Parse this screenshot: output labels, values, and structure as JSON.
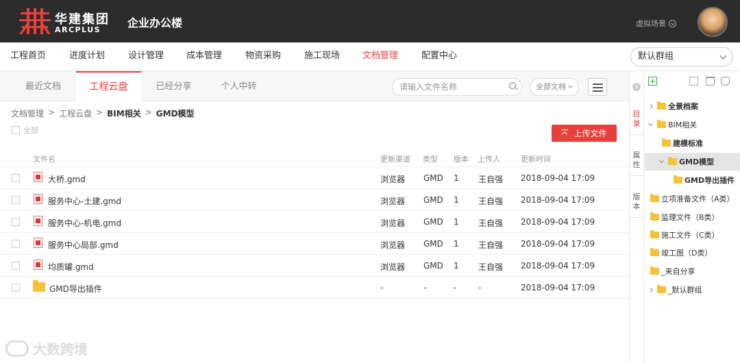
{
  "header": {
    "brand_cn": "华建集团",
    "brand_en": "ARCPLUS",
    "app_title": "企业办公楼",
    "scene_label": "虚拟场景",
    "brand_color": "#e8403c"
  },
  "nav": {
    "items": [
      "工程首页",
      "进度计划",
      "设计管理",
      "成本管理",
      "物资采购",
      "施工现场",
      "文档管理",
      "配置中心"
    ],
    "active": "文档管理",
    "group_select": "默认群组"
  },
  "tabs": {
    "items": [
      "最近文档",
      "工程云盘",
      "已经分享",
      "个人中转"
    ],
    "active": "工程云盘"
  },
  "toolbar": {
    "search_placeholder": "请输入文件名称",
    "filter_label": "全部文档",
    "upload_label": "上传文件"
  },
  "breadcrumb": [
    "文档管理",
    "工程云盘",
    "BIM相关",
    "GMD模型"
  ],
  "select_all_label": "全部",
  "table": {
    "columns": [
      "文件名",
      "更新渠道",
      "类型",
      "版本",
      "上传人",
      "更新时间"
    ],
    "rows": [
      {
        "name": "大桥.gmd",
        "channel": "浏览器",
        "type": "GMD",
        "version": "1",
        "uploader": "王自强",
        "time": "2018-09-04 17:09",
        "kind": "file"
      },
      {
        "name": "服务中心-土建.gmd",
        "channel": "浏览器",
        "type": "GMD",
        "version": "1",
        "uploader": "王自强",
        "time": "2018-09-04 17:09",
        "kind": "file"
      },
      {
        "name": "服务中心-机电.gmd",
        "channel": "浏览器",
        "type": "GMD",
        "version": "1",
        "uploader": "王自强",
        "time": "2018-09-04 17:09",
        "kind": "file"
      },
      {
        "name": "服务中心局部.gmd",
        "channel": "浏览器",
        "type": "GMD",
        "version": "1",
        "uploader": "王自强",
        "time": "2018-09-04 17:09",
        "kind": "file"
      },
      {
        "name": "均质罐.gmd",
        "channel": "浏览器",
        "type": "GMD",
        "version": "1",
        "uploader": "王自强",
        "time": "2018-09-04 17:09",
        "kind": "file"
      },
      {
        "name": "GMD导出插件",
        "channel": "-",
        "type": "-",
        "version": "-",
        "uploader": "-",
        "time": "2018-09-04 17:09",
        "kind": "folder"
      }
    ]
  },
  "side_tabs": [
    "目录",
    "属性",
    "版本"
  ],
  "tree": {
    "nodes": [
      {
        "label": "全景档案",
        "bold": true,
        "arrow": "right"
      },
      {
        "label": "BIM相关",
        "bold": false,
        "arrow": "down"
      },
      {
        "label": "建模标准",
        "bold": true,
        "arrow": ""
      },
      {
        "label": "GMD模型",
        "bold": true,
        "arrow": "down",
        "selected": true
      },
      {
        "label": "GMD导出插件",
        "bold": true,
        "arrow": ""
      },
      {
        "label": "立项准备文件（A类）",
        "bold": false,
        "arrow": ""
      },
      {
        "label": "监理文件（B类）",
        "bold": false,
        "arrow": ""
      },
      {
        "label": "施工文件（C类）",
        "bold": false,
        "arrow": ""
      },
      {
        "label": "竣工图（D类）",
        "bold": false,
        "arrow": ""
      },
      {
        "label": "_来自分享",
        "bold": false,
        "arrow": ""
      },
      {
        "label": "_默认群组",
        "bold": false,
        "arrow": "right"
      }
    ]
  },
  "watermark": "大数跨境"
}
